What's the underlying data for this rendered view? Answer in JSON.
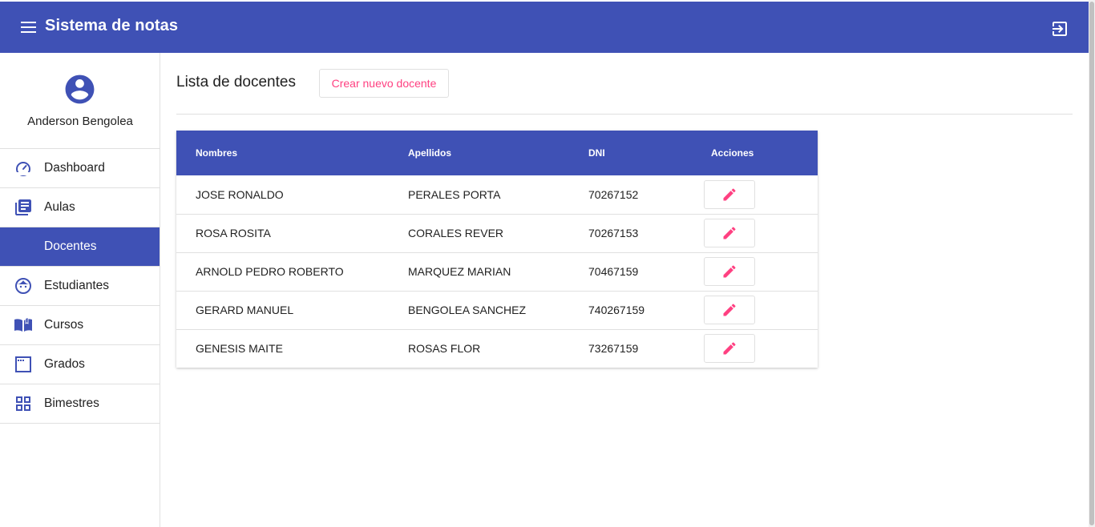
{
  "header": {
    "title": "Sistema de notas",
    "menu_icon": "menu-icon",
    "logout_icon": "logout-icon"
  },
  "sidebar": {
    "user_name": "Anderson Bengolea",
    "avatar_icon": "account-circle-icon",
    "items": [
      {
        "label": "Dashboard",
        "icon": "speedometer-icon",
        "active": false
      },
      {
        "label": "Aulas",
        "icon": "library-books-icon",
        "active": false
      },
      {
        "label": "Docentes",
        "icon": "",
        "active": true
      },
      {
        "label": "Estudiantes",
        "icon": "face-icon",
        "active": false
      },
      {
        "label": "Cursos",
        "icon": "book-open-icon",
        "active": false
      },
      {
        "label": "Grados",
        "icon": "window-icon",
        "active": false
      },
      {
        "label": "Bimestres",
        "icon": "grid-icon",
        "active": false
      }
    ]
  },
  "main": {
    "title": "Lista de docentes",
    "create_label": "Crear nuevo docente",
    "table": {
      "headers": [
        "Nombres",
        "Apellidos",
        "DNI",
        "Acciones"
      ],
      "rows": [
        {
          "nombres": "JOSE RONALDO",
          "apellidos": "PERALES PORTA",
          "dni": "70267152"
        },
        {
          "nombres": "ROSA ROSITA",
          "apellidos": "CORALES REVER",
          "dni": "70267153"
        },
        {
          "nombres": "ARNOLD PEDRO ROBERTO",
          "apellidos": "MARQUEZ MARIAN",
          "dni": "70467159"
        },
        {
          "nombres": "GERARD MANUEL",
          "apellidos": "BENGOLEA SANCHEZ",
          "dni": "740267159"
        },
        {
          "nombres": "GENESIS MAITE",
          "apellidos": "ROSAS FLOR",
          "dni": "73267159"
        }
      ],
      "action_icon": "pencil-icon"
    }
  },
  "colors": {
    "primary": "#3f51b5",
    "accent": "#ff4081"
  }
}
